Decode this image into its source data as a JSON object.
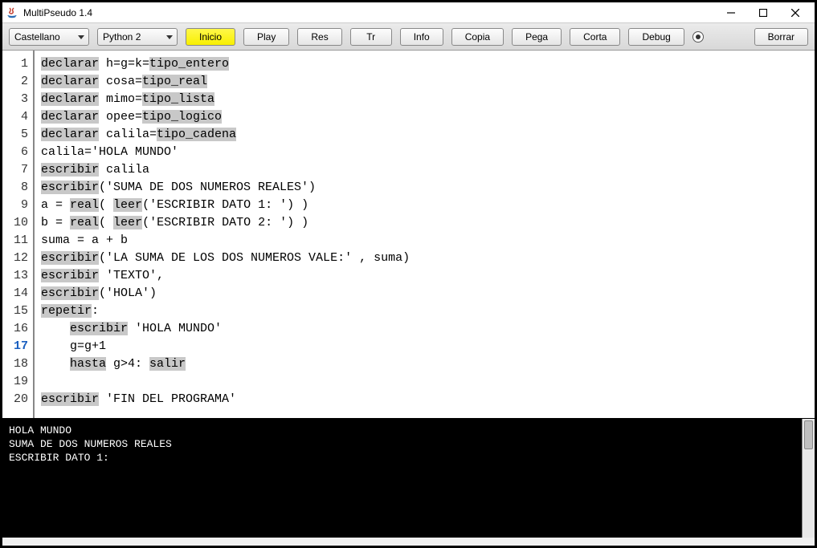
{
  "window": {
    "title": "MultiPseudo 1.4"
  },
  "toolbar": {
    "lang_select": "Castellano",
    "py_select": "Python 2",
    "buttons": {
      "inicio": "Inicio",
      "play": "Play",
      "res": "Res",
      "tr": "Tr",
      "info": "Info",
      "copia": "Copia",
      "pega": "Pega",
      "corta": "Corta",
      "debug": "Debug",
      "borrar": "Borrar"
    }
  },
  "editor": {
    "current_line": "17",
    "lines": [
      {
        "n": "1",
        "segs": [
          [
            "declarar",
            1
          ],
          [
            " h=g=k=",
            0
          ],
          [
            "tipo_entero",
            1
          ]
        ]
      },
      {
        "n": "2",
        "segs": [
          [
            "declarar",
            1
          ],
          [
            " cosa=",
            0
          ],
          [
            "tipo_real",
            1
          ]
        ]
      },
      {
        "n": "3",
        "segs": [
          [
            "declarar",
            1
          ],
          [
            " mimo=",
            0
          ],
          [
            "tipo_lista",
            1
          ]
        ]
      },
      {
        "n": "4",
        "segs": [
          [
            "declarar",
            1
          ],
          [
            " opee=",
            0
          ],
          [
            "tipo_logico",
            1
          ]
        ]
      },
      {
        "n": "5",
        "segs": [
          [
            "declarar",
            1
          ],
          [
            " calila=",
            0
          ],
          [
            "tipo_cadena",
            1
          ]
        ]
      },
      {
        "n": "6",
        "segs": [
          [
            "calila='HOLA MUNDO'",
            0
          ]
        ]
      },
      {
        "n": "7",
        "segs": [
          [
            "escribir",
            1
          ],
          [
            " calila",
            0
          ]
        ]
      },
      {
        "n": "8",
        "segs": [
          [
            "escribir",
            1
          ],
          [
            "('SUMA DE DOS NUMEROS REALES')",
            0
          ]
        ]
      },
      {
        "n": "9",
        "segs": [
          [
            "a = ",
            0
          ],
          [
            "real",
            1
          ],
          [
            "( ",
            0
          ],
          [
            "leer",
            1
          ],
          [
            "('ESCRIBIR DATO 1: ') )",
            0
          ]
        ]
      },
      {
        "n": "10",
        "segs": [
          [
            "b = ",
            0
          ],
          [
            "real",
            1
          ],
          [
            "( ",
            0
          ],
          [
            "leer",
            1
          ],
          [
            "('ESCRIBIR DATO 2: ') )",
            0
          ]
        ]
      },
      {
        "n": "11",
        "segs": [
          [
            "suma = a + b",
            0
          ]
        ]
      },
      {
        "n": "12",
        "segs": [
          [
            "escribir",
            1
          ],
          [
            "('LA SUMA DE LOS DOS NUMEROS VALE:' , suma)",
            0
          ]
        ]
      },
      {
        "n": "13",
        "segs": [
          [
            "escribir",
            1
          ],
          [
            " 'TEXTO',",
            0
          ]
        ]
      },
      {
        "n": "14",
        "segs": [
          [
            "escribir",
            1
          ],
          [
            "('HOLA')",
            0
          ]
        ]
      },
      {
        "n": "15",
        "segs": [
          [
            "repetir",
            1
          ],
          [
            ":",
            0
          ]
        ]
      },
      {
        "n": "16",
        "segs": [
          [
            "    ",
            0
          ],
          [
            "escribir",
            1
          ],
          [
            " 'HOLA MUNDO'",
            0
          ]
        ]
      },
      {
        "n": "17",
        "segs": [
          [
            "    g=g+1",
            0
          ]
        ]
      },
      {
        "n": "18",
        "segs": [
          [
            "    ",
            0
          ],
          [
            "hasta",
            1
          ],
          [
            " g>4: ",
            0
          ],
          [
            "salir",
            1
          ]
        ]
      },
      {
        "n": "19",
        "segs": [
          [
            "",
            0
          ]
        ]
      },
      {
        "n": "20",
        "segs": [
          [
            "escribir",
            1
          ],
          [
            " 'FIN DEL PROGRAMA'",
            0
          ]
        ]
      }
    ]
  },
  "console": {
    "lines": [
      "HOLA MUNDO",
      "SUMA DE DOS NUMEROS REALES",
      "ESCRIBIR DATO 1: "
    ]
  }
}
